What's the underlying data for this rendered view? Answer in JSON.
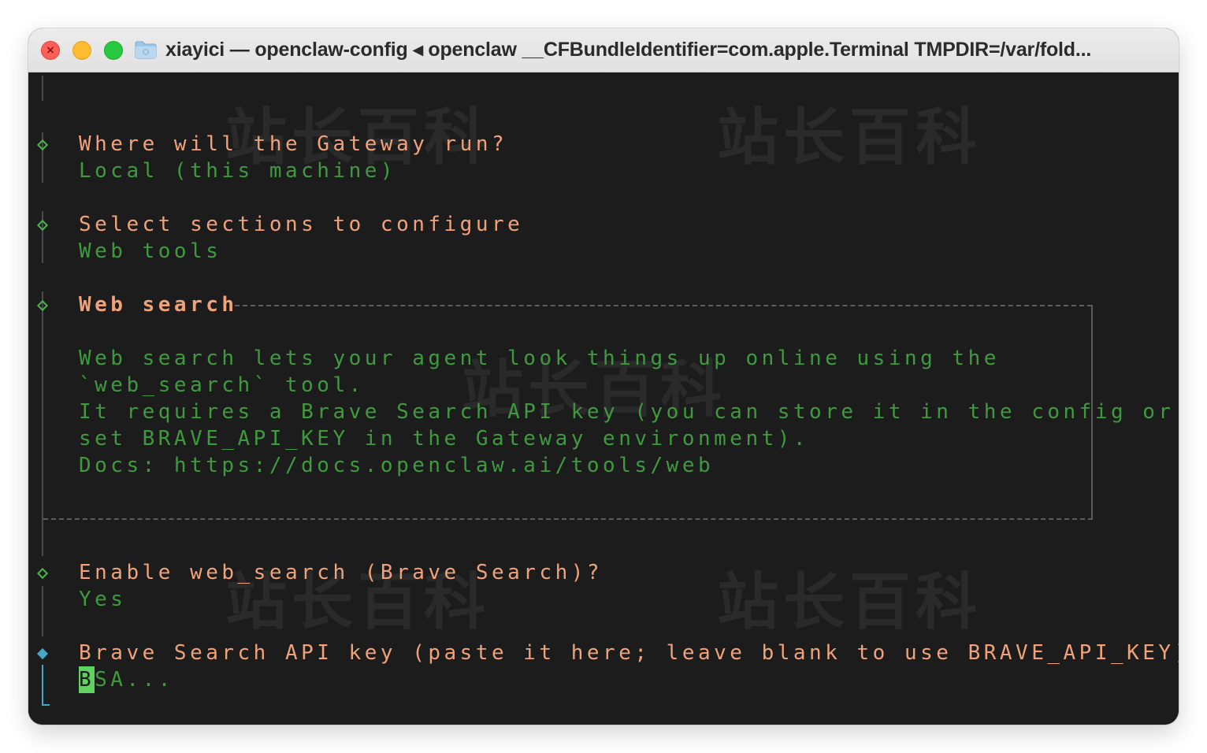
{
  "window": {
    "title": "xiayici — openclaw-config ◂ openclaw __CFBundleIdentifier=com.apple.Terminal TMPDIR=/var/fold..."
  },
  "watermark": "站长百科",
  "steps": {
    "gateway": {
      "question": "Where will the Gateway run?",
      "answer": "Local (this machine)"
    },
    "sections": {
      "question": "Select sections to configure",
      "answer": "Web tools"
    },
    "web_search": {
      "heading": "Web search",
      "lines": [
        "Web search lets your agent look things up online using the",
        "`web_search` tool.",
        "It requires a Brave Search API key (you can store it in the config or",
        "set BRAVE_API_KEY in the Gateway environment).",
        "Docs: https://docs.openclaw.ai/tools/web"
      ]
    },
    "enable": {
      "question": "Enable web_search (Brave Search)?",
      "answer": "Yes"
    },
    "api_key": {
      "question": "Brave Search API key (paste it here; leave blank to use BRAVE_API_KEY)",
      "cursor_char": "B",
      "placeholder_rest": "SA..."
    }
  },
  "colors": {
    "prompt": "#f0a27a",
    "answer": "#3f9a3f",
    "active_marker": "#46a6c8",
    "done_marker": "#4cb34c"
  }
}
